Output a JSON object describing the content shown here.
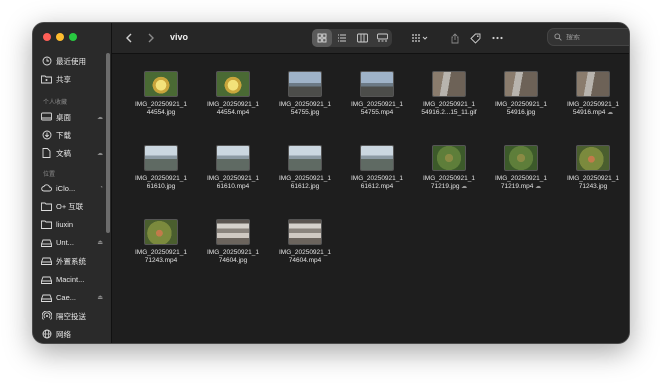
{
  "toolbar": {
    "title": "vivo",
    "search_placeholder": "搜索"
  },
  "sidebar": {
    "favorites": [
      {
        "label": "最近使用",
        "icon": "clock-icon"
      },
      {
        "label": "共享",
        "icon": "shared-folder-icon"
      }
    ],
    "personal_header": "个人收藏",
    "personal": [
      {
        "label": "桌面",
        "icon": "desktop-icon",
        "extra": "☁"
      },
      {
        "label": "下载",
        "icon": "download-icon",
        "extra": ""
      },
      {
        "label": "文稿",
        "icon": "document-icon",
        "extra": "☁"
      }
    ],
    "locations_header": "位置",
    "locations": [
      {
        "label": "iClo...",
        "icon": "icloud-icon",
        "extra": "◔"
      },
      {
        "label": "O+ 互联",
        "icon": "folder-icon",
        "extra": ""
      },
      {
        "label": "liuxin",
        "icon": "folder-icon",
        "extra": ""
      },
      {
        "label": "Unt...",
        "icon": "drive-icon",
        "extra": "⏏"
      },
      {
        "label": "外置系统",
        "icon": "drive-icon",
        "extra": ""
      },
      {
        "label": "Macint...",
        "icon": "drive-icon",
        "extra": ""
      },
      {
        "label": "Cae...",
        "icon": "drive-icon",
        "extra": "⏏"
      },
      {
        "label": "隔空投送",
        "icon": "airdrop-icon",
        "extra": ""
      },
      {
        "label": "网络",
        "icon": "network-icon",
        "extra": ""
      }
    ]
  },
  "files": [
    {
      "line1": "IMG_20250921_1",
      "line2": "44554.jpg",
      "thumb": "flower",
      "cloud": false
    },
    {
      "line1": "IMG_20250921_1",
      "line2": "44554.mp4",
      "thumb": "flower",
      "cloud": false
    },
    {
      "line1": "IMG_20250921_1",
      "line2": "54755.jpg",
      "thumb": "sky",
      "cloud": false
    },
    {
      "line1": "IMG_20250921_1",
      "line2": "54755.mp4",
      "thumb": "sky",
      "cloud": false
    },
    {
      "line1": "IMG_20250921_1",
      "line2": "54916.2...15_11.gif",
      "thumb": "street",
      "cloud": false
    },
    {
      "line1": "IMG_20250921_1",
      "line2": "54916.jpg",
      "thumb": "street",
      "cloud": false
    },
    {
      "line1": "IMG_20250921_1",
      "line2": "54916.mp4",
      "thumb": "street",
      "cloud": true
    },
    {
      "line1": "IMG_20250921_1",
      "line2": "61610.jpg",
      "thumb": "road",
      "cloud": false
    },
    {
      "line1": "IMG_20250921_1",
      "line2": "61610.mp4",
      "thumb": "road",
      "cloud": false
    },
    {
      "line1": "IMG_20250921_1",
      "line2": "61612.jpg",
      "thumb": "road",
      "cloud": false
    },
    {
      "line1": "IMG_20250921_1",
      "line2": "61612.mp4",
      "thumb": "road",
      "cloud": false
    },
    {
      "line1": "IMG_20250921_1",
      "line2": "71219.jpg",
      "thumb": "green",
      "cloud": true
    },
    {
      "line1": "IMG_20250921_1",
      "line2": "71219.mp4",
      "thumb": "green",
      "cloud": true
    },
    {
      "line1": "IMG_20250921_1",
      "line2": "71243.jpg",
      "thumb": "leaf",
      "cloud": false
    },
    {
      "line1": "IMG_20250921_1",
      "line2": "71243.mp4",
      "thumb": "leaf",
      "cloud": false
    },
    {
      "line1": "IMG_20250921_1",
      "line2": "74604.jpg",
      "thumb": "ceiling",
      "cloud": false
    },
    {
      "line1": "IMG_20250921_1",
      "line2": "74604.mp4",
      "thumb": "ceiling",
      "cloud": false
    }
  ],
  "colors": {
    "close": "#ff5f57",
    "minimize": "#febc2e",
    "zoom": "#28c840",
    "window_bg": "#1e1e1e",
    "sidebar_bg": "#2a2a2a"
  }
}
